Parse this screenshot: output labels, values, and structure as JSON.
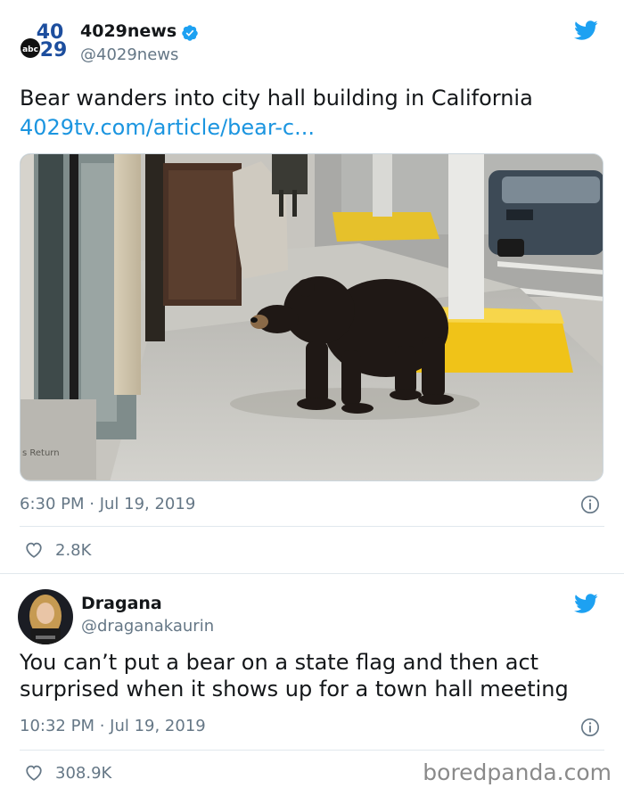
{
  "tweet1": {
    "avatar_text": "40 29 abc",
    "name": "4029news",
    "handle": "@4029news",
    "text": "Bear wanders into city hall building in California",
    "link": "4029tv.com/article/bear-c...",
    "sign_text": "s Return",
    "time": "6:30 PM · Jul 19, 2019",
    "likes": "2.8K"
  },
  "tweet2": {
    "name": "Dragana",
    "handle": "@draganakaurin",
    "text_line1": "You can’t put a bear on a state flag and then act",
    "text_line2": "surprised when it shows up for a town hall meeting",
    "time": "10:32 PM · Jul 19, 2019",
    "likes": "308.9K"
  },
  "watermark": "boredpanda.com",
  "colors": {
    "twitter_blue": "#1da1f2",
    "link_blue": "#1b95e0",
    "meta_gray": "#657786",
    "divider": "#e1e8ed"
  },
  "icons": [
    "verified-badge-icon",
    "twitter-bird-icon",
    "info-icon",
    "heart-icon"
  ]
}
